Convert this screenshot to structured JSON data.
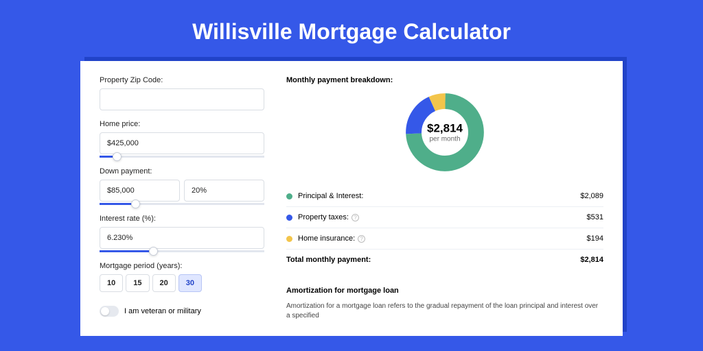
{
  "title": "Willisville Mortgage Calculator",
  "form": {
    "zip": {
      "label": "Property Zip Code:",
      "value": ""
    },
    "price": {
      "label": "Home price:",
      "value": "$425,000",
      "slider_pct": 8
    },
    "down": {
      "label": "Down payment:",
      "value": "$85,000",
      "pct": "20%",
      "slider_pct": 19
    },
    "rate": {
      "label": "Interest rate (%):",
      "value": "6.230%",
      "slider_pct": 30
    },
    "period": {
      "label": "Mortgage period (years):",
      "options": [
        "10",
        "15",
        "20",
        "30"
      ],
      "selected": "30"
    },
    "veteran": {
      "label": "I am veteran or military"
    }
  },
  "breakdown": {
    "title": "Monthly payment breakdown:",
    "total": "$2,814",
    "sub": "per month",
    "items": [
      {
        "label": "Principal & Interest:",
        "value": "$2,089",
        "color": "green"
      },
      {
        "label": "Property taxes:",
        "value": "$531",
        "color": "blue",
        "help": true
      },
      {
        "label": "Home insurance:",
        "value": "$194",
        "color": "yellow",
        "help": true
      }
    ],
    "total_row": {
      "label": "Total monthly payment:",
      "value": "$2,814"
    }
  },
  "amortization": {
    "title": "Amortization for mortgage loan",
    "text": "Amortization for a mortgage loan refers to the gradual repayment of the loan principal and interest over a specified"
  },
  "chart_data": {
    "type": "pie",
    "title": "Monthly payment breakdown",
    "series": [
      {
        "name": "Principal & Interest",
        "value": 2089
      },
      {
        "name": "Property taxes",
        "value": 531
      },
      {
        "name": "Home insurance",
        "value": 194
      }
    ],
    "total": 2814
  }
}
